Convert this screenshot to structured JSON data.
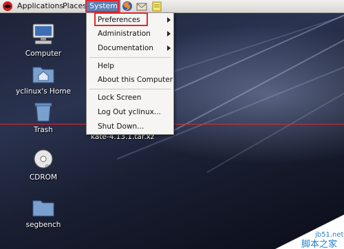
{
  "panel": {
    "applications": "Applications",
    "places": "Places",
    "system": "System",
    "launchers": [
      "firefox-icon",
      "mail-icon",
      "notes-icon"
    ]
  },
  "system_menu": {
    "items": [
      {
        "label": "Preferences",
        "submenu": true
      },
      {
        "label": "Administration",
        "submenu": true
      },
      {
        "label": "Documentation",
        "submenu": true
      },
      {
        "label": "Help",
        "submenu": false
      },
      {
        "label": "About this Computer",
        "submenu": false
      },
      {
        "label": "Lock Screen",
        "submenu": false
      },
      {
        "label": "Log Out yclinux...",
        "submenu": false
      },
      {
        "label": "Shut Down...",
        "submenu": false
      }
    ]
  },
  "desktop": {
    "icons": [
      {
        "label": "Computer",
        "icon": "computer-icon"
      },
      {
        "label": "yclinux's Home",
        "icon": "home-folder-icon"
      },
      {
        "label": "Trash",
        "icon": "trash-icon"
      },
      {
        "label": "CDROM",
        "icon": "cdrom-icon"
      },
      {
        "label": "segbench",
        "icon": "folder-icon"
      }
    ],
    "file_label": "kate-4.13.1.tar.xz"
  },
  "watermark": {
    "site": "jb51.net",
    "text": "脚本之家"
  },
  "colors": {
    "annotation_red": "#e2262b",
    "selected_menu": "#5c7fb3"
  }
}
